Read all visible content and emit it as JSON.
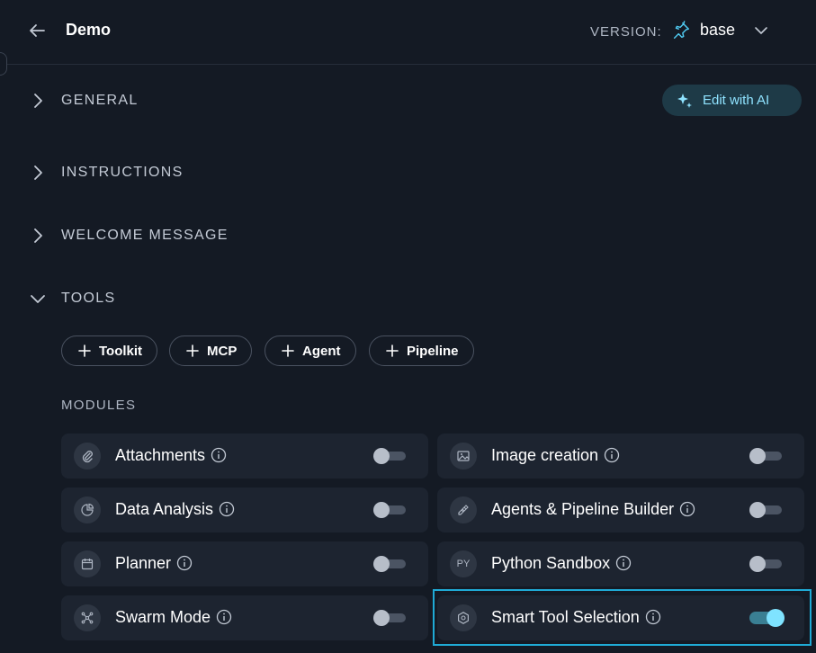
{
  "header": {
    "title": "Demo",
    "version_label": "VERSION:",
    "version_value": "base"
  },
  "sections": {
    "general": "GENERAL",
    "instructions": "INSTRUCTIONS",
    "welcome": "WELCOME MESSAGE",
    "tools": "TOOLS"
  },
  "edit_ai": {
    "label": "Edit with AI"
  },
  "tool_buttons": [
    "Toolkit",
    "MCP",
    "Agent",
    "Pipeline"
  ],
  "modules": {
    "label": "MODULES",
    "items": [
      {
        "label": "Attachments",
        "icon": "paperclip-icon",
        "enabled": false
      },
      {
        "label": "Image creation",
        "icon": "image-icon",
        "enabled": false
      },
      {
        "label": "Data Analysis",
        "icon": "chart-pie-icon",
        "enabled": false
      },
      {
        "label": "Agents & Pipeline Builder",
        "icon": "builder-icon",
        "enabled": false
      },
      {
        "label": "Planner",
        "icon": "calendar-icon",
        "enabled": false
      },
      {
        "label": "Python Sandbox",
        "icon": "PY",
        "enabled": false
      },
      {
        "label": "Swarm Mode",
        "icon": "swarm-icon",
        "enabled": false
      },
      {
        "label": "Smart Tool Selection",
        "icon": "hexagon-icon",
        "enabled": true
      }
    ]
  },
  "colors": {
    "background": "#141a24",
    "card": "#1d2430",
    "accent": "#7fe3ff",
    "highlight": "#1faad5"
  }
}
